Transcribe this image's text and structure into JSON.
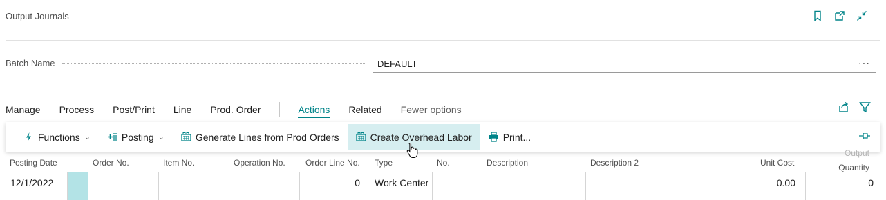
{
  "page": {
    "title": "Output Journals"
  },
  "top_icons": [
    "bookmark-icon",
    "open-in-new-window-icon",
    "collapse-icon"
  ],
  "batch": {
    "label": "Batch Name",
    "value": "DEFAULT",
    "more": "···"
  },
  "menu": {
    "items": [
      "Manage",
      "Process",
      "Post/Print",
      "Line",
      "Prod. Order"
    ],
    "active": "Actions",
    "related": "Related",
    "fewer": "Fewer options"
  },
  "actions": {
    "functions": "Functions",
    "posting": "Posting",
    "generate": "Generate Lines from Prod Orders",
    "overhead": "Create Overhead Labor",
    "print": "Print..."
  },
  "columns": {
    "posting_date": "Posting Date",
    "order_no": "Order No.",
    "item_no": "Item No.",
    "operation_no": "Operation No.",
    "order_line_no": "Order Line No.",
    "type": "Type",
    "no": "No.",
    "description": "Description",
    "description2": "Description 2",
    "unit_cost": "Unit Cost",
    "output_quantity_1": "Output",
    "output_quantity_2": "Quantity"
  },
  "row": {
    "posting_date": "12/1/2022",
    "order_no": "",
    "item_no": "",
    "operation_no": "",
    "order_line_no": "0",
    "type": "Work Center",
    "no": "",
    "description": "",
    "description2": "",
    "unit_cost": "0.00",
    "output_quantity": "0"
  },
  "colors": {
    "accent": "#008489",
    "hover": "#d6eef0",
    "selected": "#b3e3e6"
  }
}
